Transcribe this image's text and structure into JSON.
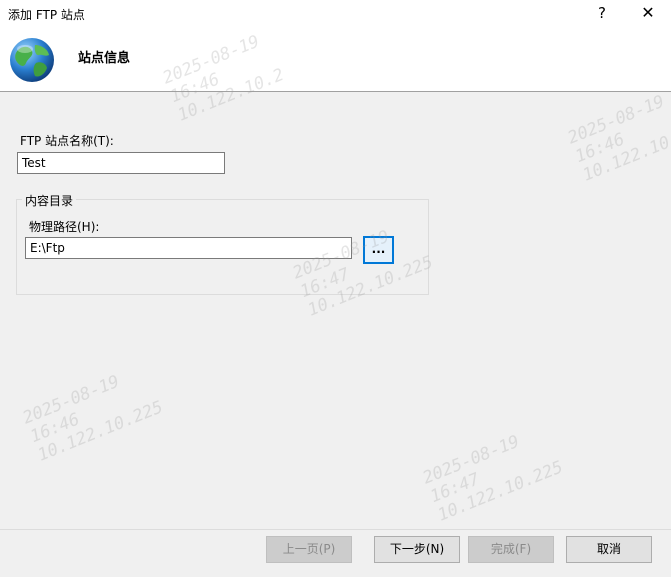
{
  "window": {
    "title": "添加 FTP 站点",
    "help_glyph": "?",
    "close_glyph": "✕"
  },
  "header": {
    "title": "站点信息",
    "icon": "globe-icon"
  },
  "form": {
    "site_name_label": "FTP 站点名称(T):",
    "site_name_value": "Test",
    "content_group_label": "内容目录",
    "physical_path_label": "物理路径(H):",
    "physical_path_value": "E:\\Ftp",
    "browse_label": "..."
  },
  "buttons": {
    "prev": "上一页(P)",
    "next": "下一步(N)",
    "finish": "完成(F)",
    "cancel": "取消"
  },
  "watermark": {
    "date": "2025-08-19",
    "time": "16:46",
    "time_alt": "16:47",
    "ip": "10.122.10.225",
    "ip_short": "10.122.10.2",
    "ip_tail": "122.10.225"
  },
  "colors": {
    "accent": "#0078d7",
    "background": "#f0f0f0"
  }
}
